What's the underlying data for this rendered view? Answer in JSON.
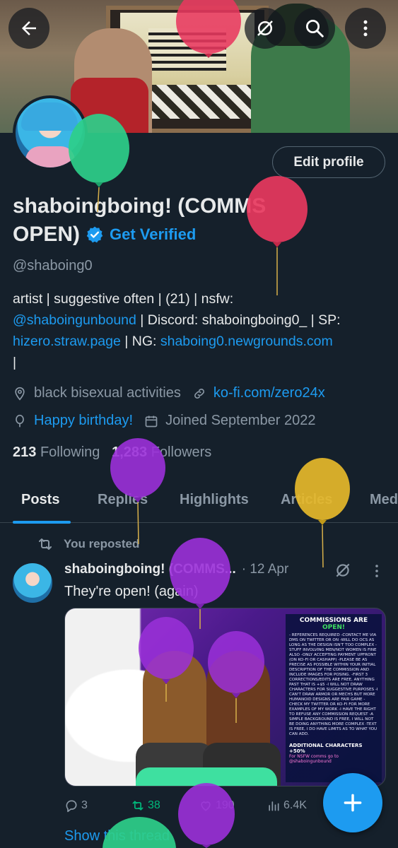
{
  "header": {
    "back_icon": "arrow-left-icon",
    "grok_icon": "grok-icon",
    "search_icon": "search-icon",
    "more_icon": "more-vertical-icon"
  },
  "profile": {
    "edit_label": "Edit profile",
    "name_line1": "shaboingboing! (COMMS",
    "name_line2": "OPEN)",
    "get_verified": "Get Verified",
    "handle": "@shaboing0",
    "bio_line1": "artist | suggestive often | (21) | nsfw:",
    "bio_link1": "@shaboingunbound",
    "bio_mid1": " | Discord: shaboingboing0_ | SP:",
    "bio_link2": "hizero.straw.page",
    "bio_mid2": " | NG: ",
    "bio_link3": "shaboing0.newgrounds.com",
    "bio_tail": "|",
    "location": "black bisexual activities",
    "website": "ko-fi.com/zero24x",
    "birthday": "Happy birthday!",
    "joined": "Joined September 2022",
    "following_count": "213",
    "following_label": "Following",
    "followers_count": "1,283",
    "followers_label": "Followers"
  },
  "tabs": [
    {
      "label": "Posts"
    },
    {
      "label": "Replies"
    },
    {
      "label": "Highlights"
    },
    {
      "label": "Articles"
    },
    {
      "label": "Med"
    }
  ],
  "post": {
    "repost_label": "You reposted",
    "author": "shaboingboing! (COMMS...",
    "date": "· 12 Apr",
    "text": "They're open! (again)",
    "media": {
      "title_a": "COMMISSIONS ARE ",
      "title_b": "OPEN!",
      "body": "- References required -Contact me via DMs on Twitter or on -Will do OCs as long as the design isn't too complex -Stuff involving men/not women is fine also -Only accepting payment upfront (on ko-fi or cashapp) -Please be as precise as possible within your initial description of the commission and include images for posing. -First 3 corrections/edits are free, anything past that is +$5 -I will not draw characters for suggestive purposes -I can't draw armor or mechs but more humanoid designs are fair game -Check my Twitter or Ko-fi for more examples of my work -I have the right to refuse any commission request -A simple background is free, I will not be doing anything more complex -Text is free, I do have limits as to what you can add.",
      "footer": "ADDITIONAL CHARACTERS +50%",
      "footer2": "For NSFW comms go to @shaboingunbound"
    },
    "replies": "3",
    "reposts": "38",
    "likes": "190",
    "views": "6.4K",
    "show_thread": "Show this thread"
  },
  "colors": {
    "background": "#15202b",
    "accent": "#1d9bf0",
    "secondary_text": "#8b98a5",
    "repost_green": "#00ba7c"
  }
}
